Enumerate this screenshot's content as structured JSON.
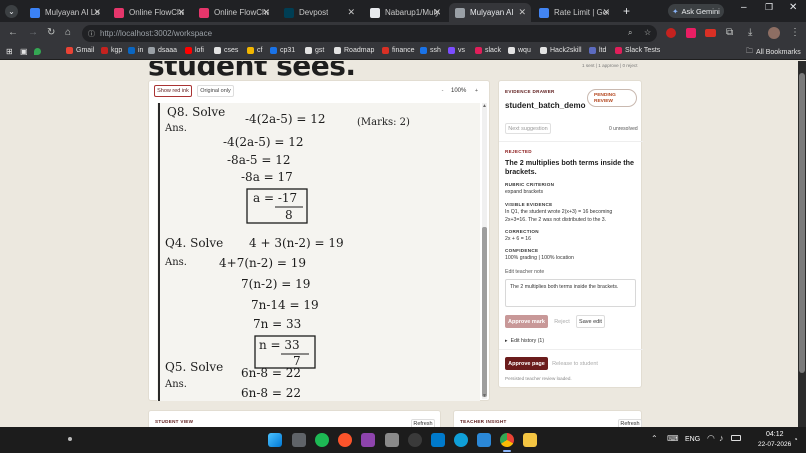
{
  "browser": {
    "tabs": [
      {
        "title": "Mulyayan AI Login",
        "color": "#3b82f6",
        "active": false
      },
      {
        "title": "Online FlowChart",
        "color": "#e6366b",
        "active": false
      },
      {
        "title": "Online FlowChart",
        "color": "#e6366b",
        "active": false
      },
      {
        "title": "Devpost",
        "color": "#003e54",
        "active": false
      },
      {
        "title": "Nabarup1/Mulyayan",
        "color": "#e8eaed",
        "active": false
      },
      {
        "title": "Mulyayan AI",
        "color": "#9aa0a6",
        "active": true
      },
      {
        "title": "Rate Limit | Google",
        "color": "#4285f4",
        "active": false
      }
    ],
    "new_tab": "+",
    "ask_gemini": "Ask Gemini",
    "url_host": "http://localhost",
    "url_rest": ":3002/workspace",
    "bookmarks": [
      {
        "label": "Gmail",
        "color": "#ea4335"
      },
      {
        "label": "kgp",
        "color": "#c5221f"
      },
      {
        "label": "in",
        "color": "#0a66c2"
      },
      {
        "label": "dsaaa",
        "color": "#9aa0a6"
      },
      {
        "label": "lofi",
        "color": "#ff0000"
      },
      {
        "label": "cses",
        "color": "#e3e3e3"
      },
      {
        "label": "cf",
        "color": "#f2b600"
      },
      {
        "label": "cp31",
        "color": "#1a73e8"
      },
      {
        "label": "gst",
        "color": "#e3e3e3"
      },
      {
        "label": "Roadmap",
        "color": "#e3e3e3"
      },
      {
        "label": "finance",
        "color": "#d93025"
      },
      {
        "label": "ssh",
        "color": "#1a73e8"
      },
      {
        "label": "vs",
        "color": "#7c4dff"
      },
      {
        "label": "slack",
        "color": "#e01e5a"
      },
      {
        "label": "wqu",
        "color": "#e3e3e3"
      },
      {
        "label": "Hack2skill",
        "color": "#e3e3e3"
      },
      {
        "label": "ltd",
        "color": "#5c6bc0"
      },
      {
        "label": "Slack Tests",
        "color": "#e01e5a"
      }
    ],
    "all_bookmarks": "All Bookmarks"
  },
  "page": {
    "heading": "student sees.",
    "top_right_note": "1 sent | 1 approve | 0 reject",
    "viewer": {
      "show_red_ink": "Show red ink",
      "original_only": "Original only",
      "zoom_minus": "-",
      "zoom_value": "100%",
      "zoom_plus": "+",
      "handwriting": [
        "Q8. Solve",
        "-4(2a-5) = 12",
        "(Marks: 2)",
        "Ans.",
        "-4(2a-5) = 12",
        "-8a-5 = 12",
        "-8a = 17",
        "a = -17",
        "8",
        "Q4. Solve",
        "4 + 3(n-2) = 19",
        "Ans.",
        "4+7(n-2) = 19",
        "7(n-2) = 19",
        "7n-14 = 19",
        "7n = 33",
        "n = 33",
        "7",
        "Q5. Solve",
        "6n-8 = 22",
        "Ans.",
        "6n-8 = 22"
      ]
    },
    "drawer": {
      "title": "EVIDENCE DRAWER",
      "student": "student_batch_demo",
      "status": "PENDING REVIEW",
      "next_button": "Next suggestion",
      "unresolved": "0 unresolved",
      "rejected_label": "REJECTED",
      "finding": "The 2 multiplies both terms inside the brackets.",
      "rubric_label": "RUBRIC CRITERION",
      "rubric_value": "expand brackets",
      "evidence_label": "VISIBLE EVIDENCE",
      "evidence_value": "In Q1, the student wrote 2(x+3) = 16 becoming 2x+3=16. The 2 was not distributed to the 3.",
      "correction_label": "CORRECTION",
      "correction_value": "2x + 6 = 16",
      "confidence_label": "CONFIDENCE",
      "confidence_value": "100% grading | 100% location",
      "note_label": "Edit teacher note",
      "note_value": "The 2 multiplies both terms inside the brackets.",
      "approve_mark": "Approve mark",
      "reject": "Reject",
      "save_edit": "Save edit",
      "edit_history": "Edit history (1)",
      "approve_page": "Approve page",
      "release": "Release to student",
      "persisted": "Persisted teacher review loaded."
    },
    "student_view": {
      "title": "STUDENT VIEW",
      "refresh": "Refresh"
    },
    "teacher_insight": {
      "title": "TEACHER INSIGHT",
      "refresh": "Refresh"
    }
  },
  "taskbar": {
    "lang": "ENG",
    "time": "04:12",
    "date": "22-07-2026"
  },
  "colors": {
    "accent": "#6b1c1c",
    "pending": "#b4471f",
    "page_bg": "#ece8df"
  }
}
